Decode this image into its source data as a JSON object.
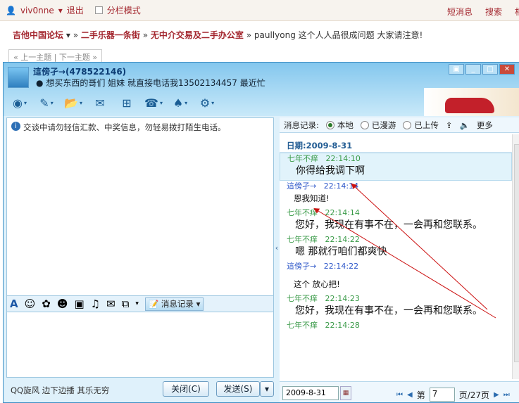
{
  "topbar": {
    "user": "viv0nne",
    "logout": "退出",
    "split_mode": "分栏模式",
    "links": [
      "短消息",
      "搜索",
      "相"
    ]
  },
  "breadcrumb": {
    "forum": "吉他中国论坛",
    "sep": "»",
    "section1": "二手乐器一条街",
    "section2": "无中介交易及二手办公室",
    "thread": "paullyong 这个人人品很成问题 大家请注意!"
  },
  "pager": "« 上一主题 | 下一主题 »",
  "qq": {
    "contact_name": "這傍孑→(478522146)",
    "status": "想买东西的哥们  姐妹  就直接电话我13502134457  最近忙",
    "warning": "交谈中请勿轻信汇款、中奖信息，勿轻易拨打陌生电话。",
    "message_log_button": "消息记录",
    "signature": "QQ旋风 边下边播 其乐无穷",
    "close_button": "关闭(C)",
    "send_button": "发送(S)",
    "log_header": {
      "label": "消息记录:",
      "options": [
        "本地",
        "已漫游",
        "已上传"
      ],
      "selected": "本地",
      "more": "更多"
    },
    "date_header": "日期:2009-8-31",
    "messages": [
      {
        "sender": "七年不痒",
        "time": "22:14:10",
        "text": "你得给我调下啊",
        "color": "green"
      },
      {
        "sender": "這傍孑→",
        "time": "22:14:14",
        "text": "恩我知道!",
        "color": "blue"
      },
      {
        "sender": "七年不痒",
        "time": "22:14:14",
        "text": "您好，我现在有事不在，一会再和您联系。",
        "color": "green"
      },
      {
        "sender": "七年不痒",
        "time": "22:14:22",
        "text": "嗯  那就行咱们都爽快",
        "color": "green"
      },
      {
        "sender": "這傍孑→",
        "time": "22:14:22",
        "text": "这个  放心把!",
        "color": "blue"
      },
      {
        "sender": "七年不痒",
        "time": "22:14:23",
        "text": "您好，我现在有事不在，一会再和您联系。",
        "color": "green"
      },
      {
        "sender": "七年不痒",
        "time": "22:14:28",
        "text": "",
        "color": "green"
      }
    ],
    "footer": {
      "date": "2009-8-31",
      "page_label": "第",
      "page": "7",
      "total": "页/27页"
    },
    "colors": {
      "accent": "#2d6fb5",
      "green_sender": "#3a9a48",
      "blue_sender": "#2b55c8",
      "annotation": "#cc1111"
    }
  }
}
